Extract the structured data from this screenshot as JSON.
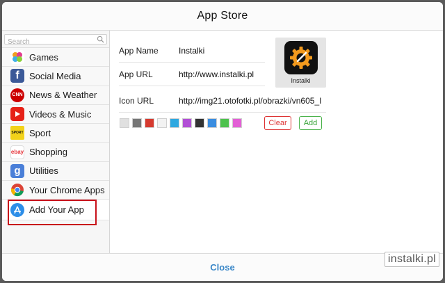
{
  "title": "App Store",
  "search": {
    "placeholder": "Search"
  },
  "sidebar": {
    "items": [
      {
        "label": "Games",
        "icon": "games-icon"
      },
      {
        "label": "Social Media",
        "icon": "facebook-icon"
      },
      {
        "label": "News & Weather",
        "icon": "cnn-icon",
        "icon_text": "CNN"
      },
      {
        "label": "Videos & Music",
        "icon": "youtube-icon"
      },
      {
        "label": "Sport",
        "icon": "sport-icon",
        "icon_text": "SPORT"
      },
      {
        "label": "Shopping",
        "icon": "ebay-icon",
        "icon_text": "ebay"
      },
      {
        "label": "Utilities",
        "icon": "google-icon",
        "icon_text": "g"
      },
      {
        "label": "Your Chrome Apps",
        "icon": "chrome-icon"
      },
      {
        "label": "Add Your App",
        "icon": "app-store-icon",
        "selected": true
      }
    ]
  },
  "form": {
    "app_name_label": "App Name",
    "app_name_value": "Instalki",
    "app_url_label": "App URL",
    "app_url_value": "http://www.instalki.pl",
    "icon_url_label": "Icon URL",
    "icon_url_value": "http://img21.otofotki.pl/obrazki/vn605_I"
  },
  "preview": {
    "app_name": "Instalki"
  },
  "swatches": [
    "#e0e0e0",
    "#777777",
    "#d63a2f",
    "#f2f2f2",
    "#2ea8e0",
    "#b24fd6",
    "#333333",
    "#3a8de0",
    "#4ec24e",
    "#e35fd6"
  ],
  "buttons": {
    "clear": "Clear",
    "add": "Add"
  },
  "footer": {
    "close": "Close"
  },
  "watermark": "instalki.pl",
  "colors": {
    "accent": "#3a87c8",
    "clear": "#dd3333",
    "add": "#3aa33a",
    "highlight": "#c8111a"
  }
}
